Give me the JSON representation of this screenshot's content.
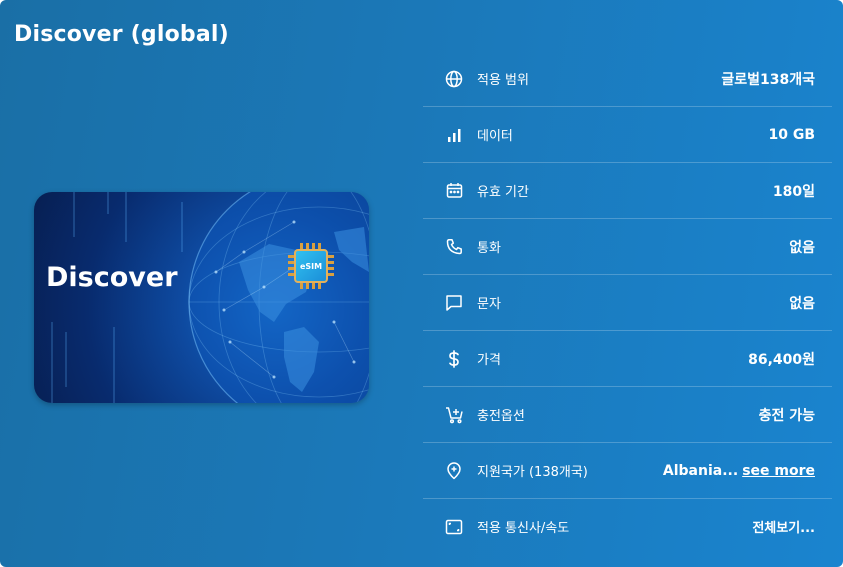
{
  "header": {
    "title": "Discover (global)"
  },
  "card": {
    "name": "Discover",
    "chip_label": "eSIM"
  },
  "rows": [
    {
      "icon": "globe-icon",
      "label": "적용 범위",
      "value": "글로벌138개국"
    },
    {
      "icon": "signal-bars-icon",
      "label": "데이터",
      "value": "10 GB"
    },
    {
      "icon": "calendar-icon",
      "label": "유효 기간",
      "value": "180일"
    },
    {
      "icon": "phone-icon",
      "label": "통화",
      "value": "없음"
    },
    {
      "icon": "chat-icon",
      "label": "문자",
      "value": "없음"
    },
    {
      "icon": "dollar-icon",
      "label": "가격",
      "value": "86,400원"
    },
    {
      "icon": "cart-plus-icon",
      "label": "충전옵션",
      "value": "충전 가능"
    },
    {
      "icon": "location-plus-icon",
      "label": "지원국가 (138개국)",
      "value": "Albania...",
      "link": "see more"
    },
    {
      "icon": "frame-icon",
      "label": "적용 통신사/속도",
      "value": "전체보기..."
    }
  ]
}
